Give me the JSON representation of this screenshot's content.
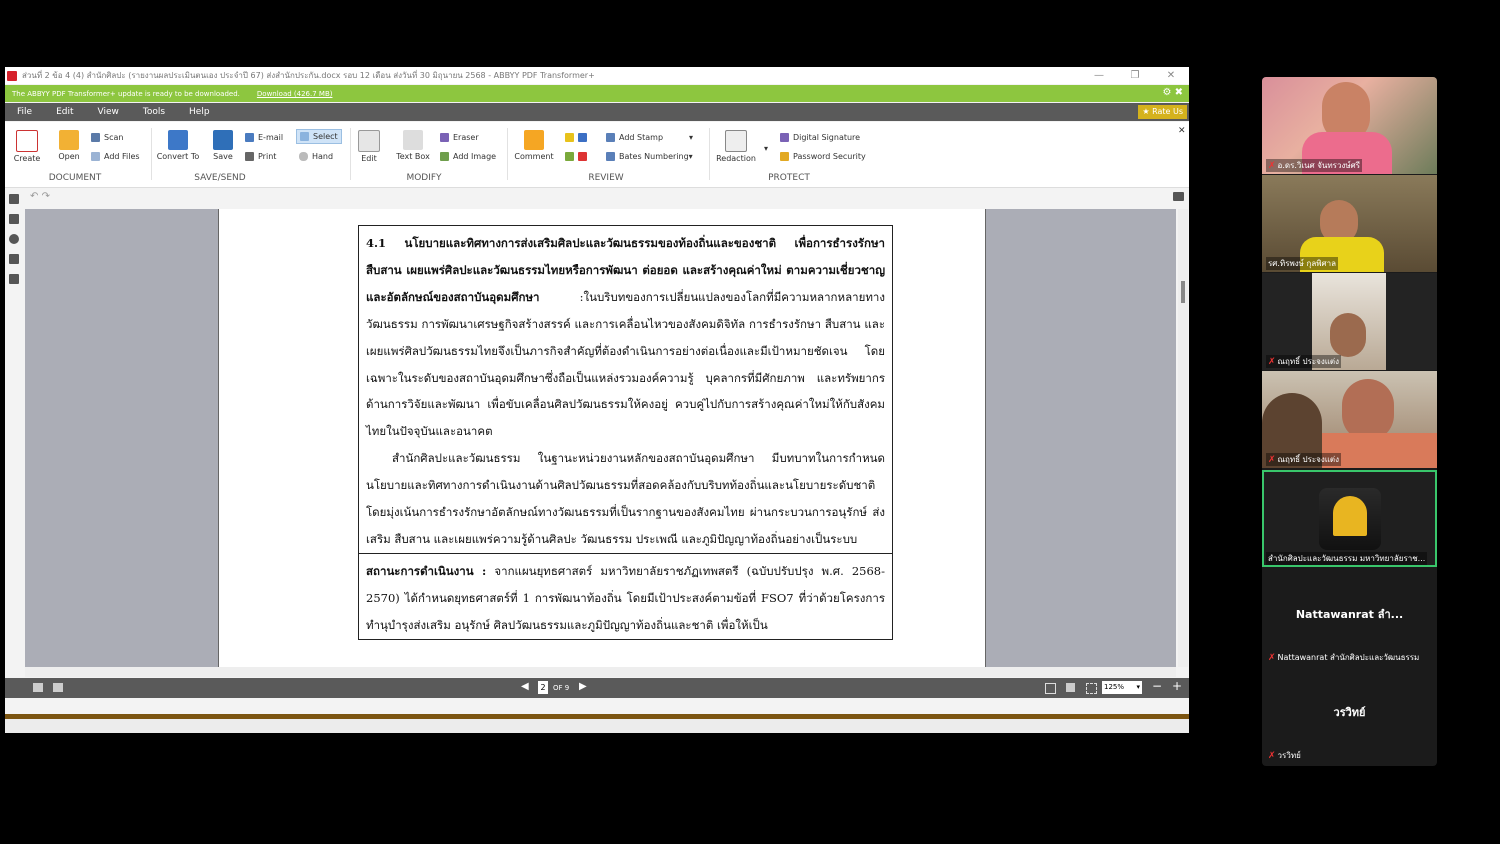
{
  "window": {
    "title": "ส่วนที่ 2 ข้อ 4 (4) สำนักศิลปะ (รายงานผลประเมินตนเอง ประจำปี 67) ส่งสำนักประกัน.docx รอบ 12 เดือน ส่งวันที่ 30 มิถุนายน 2568 - ABBYY PDF Transformer+",
    "minimize": "—",
    "restore": "❐",
    "close": "✕"
  },
  "update_bar": {
    "message": "The ABBYY PDF Transformer+ update is ready to be downloaded.",
    "download": "Download (426.7 MB)",
    "bg": "#8dc63f"
  },
  "menu": {
    "items": [
      "File",
      "Edit",
      "View",
      "Tools",
      "Help"
    ],
    "rate": "Rate Us"
  },
  "ribbon": {
    "create": "Create",
    "open": "Open",
    "scan": "Scan",
    "add_files": "Add Files",
    "convert_to": "Convert To",
    "save": "Save",
    "email": "E-mail",
    "print": "Print",
    "select": "Select",
    "hand": "Hand",
    "edit": "Edit",
    "text_box": "Text Box",
    "eraser": "Eraser",
    "add_image": "Add Image",
    "comment": "Comment",
    "add_stamp": "Add Stamp",
    "bates_numbering": "Bates Numbering",
    "redaction": "Redaction",
    "digital_signature": "Digital Signature",
    "password_security": "Password Security",
    "groups": [
      "DOCUMENT",
      "SAVE/SEND",
      "MODIFY",
      "REVIEW",
      "PROTECT"
    ]
  },
  "document": {
    "heading": "4.1 นโยบายและทิศทางการส่งเสริมศิลปะและวัฒนธรรมของท้องถิ่นและของชาติ เพื่อการธำรงรักษา สืบสาน เผยแพร่ศิลปะและวัฒนธรรมไทยหรือการพัฒนา ต่อยอด และสร้างคุณค่าใหม่ ตามความเชี่ยวชาญและอัตลักษณ์ของสถาบันอุดมศึกษา",
    "para1": " :ในบริบทของการเปลี่ยนแปลงของโลกที่มีความหลากหลายทางวัฒนธรรม การพัฒนาเศรษฐกิจสร้างสรรค์ และการเคลื่อนไหวของสังคมดิจิทัล การธำรงรักษา สืบสาน และเผยแพร่ศิลปวัฒนธรรมไทยจึงเป็นภารกิจสำคัญที่ต้องดำเนินการอย่างต่อเนื่องและมีเป้าหมายชัดเจน โดยเฉพาะในระดับของสถาบันอุดมศึกษาซึ่งถือเป็นแหล่งรวมองค์ความรู้ บุคลากรที่มีศักยภาพ และทรัพยากรด้านการวิจัยและพัฒนา เพื่อขับเคลื่อนศิลปวัฒนธรรมให้คงอยู่ ควบคู่ไปกับการสร้างคุณค่าใหม่ให้กับสังคมไทยในปัจจุบันและอนาคต",
    "para2": "สำนักศิลปะและวัฒนธรรม ในฐานะหน่วยงานหลักของสถาบันอุดมศึกษา มีบทบาทในการกำหนดนโยบายและทิศทางการดำเนินงานด้านศิลปวัฒนธรรมที่สอดคล้องกับบริบทท้องถิ่นและนโยบายระดับชาติ โดยมุ่งเน้นการธำรงรักษาอัตลักษณ์ทางวัฒนธรรมที่เป็นรากฐานของสังคมไทย ผ่านกระบวนการอนุรักษ์ ส่งเสริม สืบสาน และเผยแพร่ความรู้ด้านศิลปะ วัฒนธรรม ประเพณี และภูมิปัญญาท้องถิ่นอย่างเป็นระบบ",
    "status_label": "สถานะการดำเนินงาน :",
    "status_text": " จากแผนยุทธศาสตร์ มหาวิทยาลัยราชภัฏเทพสตรี (ฉบับปรับปรุง พ.ศ. 2568-2570) ได้กำหนดยุทธศาสตร์ที่ 1 การพัฒนาท้องถิ่น โดยมีเป้าประสงค์ตามข้อที่ FSO7 ที่ว่าด้วยโครงการทำนุบำรุงส่งเสริม อนุรักษ์ ศิลปวัฒนธรรมและภูมิปัญญาท้องถิ่นและชาติ เพื่อให้เป็น"
  },
  "status_bar": {
    "page": "2",
    "of": "OF 9",
    "zoom": "125%",
    "minus": "−",
    "plus": "+"
  },
  "participants": [
    {
      "name": "อ.ดร.วิเนศ จันทรวงษ์ศรี",
      "bg": "#c9868e"
    },
    {
      "name": "รศ.ทิรพงษ์ กุลพิศาล",
      "bg": "#7a6a4e"
    },
    {
      "name": "ณฤทธิ์ ประจงแต่ง",
      "bg": "#2a2a2a"
    },
    {
      "name": "ณฤทธิ์ ประจงแต่ง",
      "bg": "#a47862"
    },
    {
      "name": "สำนักศิลปะและวัฒนธรรม มหาวิทยาลัยราช...",
      "bg": "#1f1f1f"
    },
    {
      "display": "Nattawanrat ลำ...",
      "name": "Nattawanrat สำนักศิลปะและวัฒนธรรม",
      "bg": "#1b1b1b"
    },
    {
      "display": "วรวิทย์",
      "name": "วรวิทย์",
      "bg": "#1b1b1b"
    }
  ]
}
